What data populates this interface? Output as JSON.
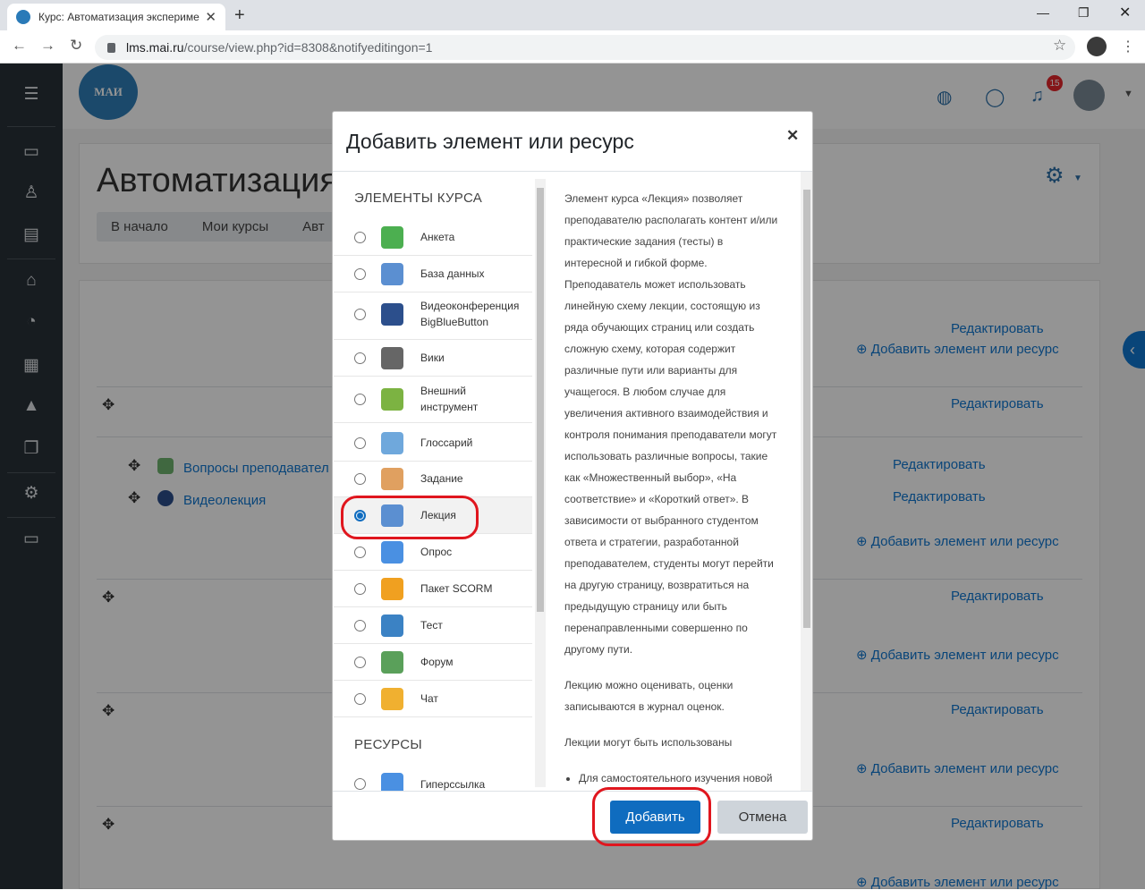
{
  "browser": {
    "tab_title": "Курс: Автоматизация экспериме",
    "url_host": "lms.mai.ru",
    "url_path": "/course/view.php?id=8308&notifyeditingon=1"
  },
  "navbar": {
    "logo_text": "МАИ",
    "notification_count": "15"
  },
  "course": {
    "title": "Автоматизация",
    "breadcrumb": [
      "В начало",
      "Мои курсы",
      "Авт"
    ]
  },
  "page": {
    "edit_label": "Редактировать",
    "add_label": "Добавить элемент или ресурс",
    "activity_1": "Вопросы преподавател",
    "activity_2": "Видеолекция"
  },
  "modal": {
    "title": "Добавить элемент или ресурс",
    "group_activities": "ЭЛЕМЕНТЫ КУРСА",
    "group_resources": "РЕСУРСЫ",
    "options": [
      {
        "label": "Анкета",
        "icon": "chart-icon",
        "color": "#4caf50"
      },
      {
        "label": "База данных",
        "icon": "database-icon",
        "color": "#5b8fd1"
      },
      {
        "label": "Видеоконференция BigBlueButton",
        "icon": "bigbluebutton-icon",
        "color": "#2c4f8c"
      },
      {
        "label": "Вики",
        "icon": "wiki-icon",
        "color": "#666666"
      },
      {
        "label": "Внешний инструмент",
        "icon": "puzzle-icon",
        "color": "#7cb342"
      },
      {
        "label": "Глоссарий",
        "icon": "glossary-icon",
        "color": "#6fa8dc"
      },
      {
        "label": "Задание",
        "icon": "assignment-icon",
        "color": "#e0a060"
      },
      {
        "label": "Лекция",
        "icon": "lesson-icon",
        "color": "#5b8fd1"
      },
      {
        "label": "Опрос",
        "icon": "question-icon",
        "color": "#4a90e2"
      },
      {
        "label": "Пакет SCORM",
        "icon": "scorm-icon",
        "color": "#f0a020"
      },
      {
        "label": "Тест",
        "icon": "quiz-icon",
        "color": "#3b82c4"
      },
      {
        "label": "Форум",
        "icon": "forum-icon",
        "color": "#5aa05a"
      },
      {
        "label": "Чат",
        "icon": "chat-icon",
        "color": "#f0b030"
      },
      {
        "label": "Гиперссылка",
        "icon": "url-icon",
        "color": "#4a90e2"
      }
    ],
    "selected": "Лекция",
    "description": [
      "Элемент курса «Лекция» позволяет преподавателю располагать контент и/или практические задания (тесты) в интересной и гибкой форме. Преподаватель может использовать линейную схему лекции, состоящую из ряда обучающих страниц или создать сложную схему, которая содержит различные пути или варианты для учащегося. В любом случае для увеличения активного взаимодействия и контроля понимания преподаватели могут использовать различные вопросы, такие как «Множественный выбор», «На соответствие» и «Короткий ответ». В зависимости от выбранного студентом ответа и стратегии, разработанной преподавателем, студенты могут перейти на другую страницу, возвратиться на предыдущую страницу или быть перенаправленными совершенно по другому пути.",
      "Лекцию можно оценивать, оценки записываются в журнал оценок.",
      "Лекции могут быть использованы"
    ],
    "description_bullet": "Для самостоятельного изучения новой",
    "btn_add": "Добавить",
    "btn_cancel": "Отмена"
  }
}
